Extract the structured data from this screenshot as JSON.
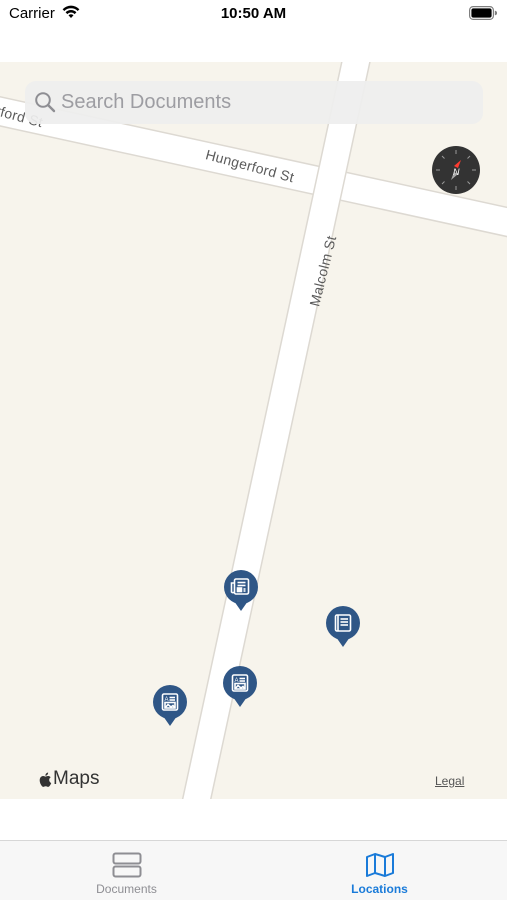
{
  "status_bar": {
    "carrier": "Carrier",
    "time": "10:50 AM",
    "icons": [
      "wifi-icon",
      "battery-icon"
    ]
  },
  "search": {
    "placeholder": "Search Documents",
    "value": ""
  },
  "map": {
    "streets": {
      "hungerford": "Hungerford St",
      "partial_ford": "rford St",
      "malcolm": "Malcolm St"
    },
    "attribution": {
      "maps_label": "Maps",
      "legal_label": "Legal"
    },
    "pins": [
      {
        "kind": "newspaper-icon",
        "color": "#2f5686"
      },
      {
        "kind": "book-icon",
        "color": "#2f5686"
      },
      {
        "kind": "photo-article-icon",
        "color": "#2f5686"
      },
      {
        "kind": "photo-article-icon",
        "color": "#2f5686"
      }
    ],
    "compass_heading": "N"
  },
  "tab_bar": {
    "tabs": [
      {
        "label": "Documents",
        "icon": "list-rows-icon",
        "selected": false
      },
      {
        "label": "Locations",
        "icon": "map-icon",
        "selected": true
      }
    ]
  },
  "colors": {
    "accent": "#1a7bd9",
    "pin": "#2f5686",
    "map_background": "#f7f4ec"
  }
}
